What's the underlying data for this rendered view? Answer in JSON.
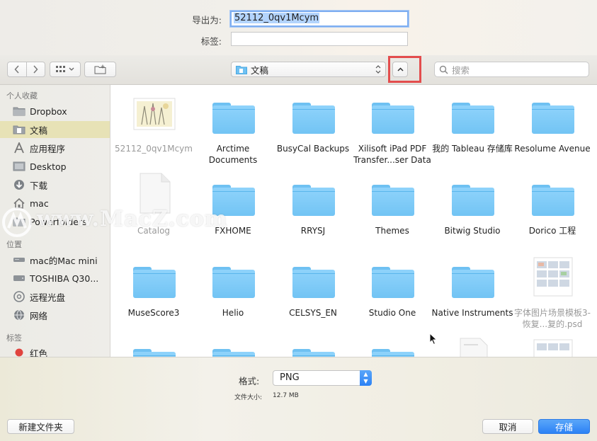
{
  "header": {
    "export_as_label": "导出为:",
    "export_as_value": "52112_0qv1Mcym",
    "tags_label": "标签:",
    "tags_value": ""
  },
  "toolbar": {
    "back_icon": "chevron-left-icon",
    "forward_icon": "chevron-right-icon",
    "view_icon": "grid-view-icon",
    "new_folder_icon": "new-folder-icon",
    "location": "文稿",
    "expand_icon": "chevron-up-icon",
    "search_placeholder": "搜索"
  },
  "sidebar": {
    "favorites_title": "个人收藏",
    "favorites": [
      {
        "label": "Dropbox",
        "icon": "folder-icon"
      },
      {
        "label": "文稿",
        "icon": "documents-icon",
        "active": true
      },
      {
        "label": "应用程序",
        "icon": "applications-icon"
      },
      {
        "label": "Desktop",
        "icon": "desktop-icon"
      },
      {
        "label": "下载",
        "icon": "downloads-icon"
      },
      {
        "label": "mac",
        "icon": "home-icon"
      },
      {
        "label": "Powerfolders",
        "icon": "folder-icon"
      }
    ],
    "locations_title": "位置",
    "locations": [
      {
        "label": "mac的Mac mini",
        "icon": "computer-icon"
      },
      {
        "label": "TOSHIBA Q30...",
        "icon": "drive-icon"
      },
      {
        "label": "远程光盘",
        "icon": "disc-icon"
      },
      {
        "label": "网络",
        "icon": "network-icon"
      }
    ],
    "tags_title": "标签",
    "tags": [
      {
        "label": "红色",
        "color": "#e0443e"
      }
    ]
  },
  "files": {
    "row1": [
      {
        "name": "52112_0qv1Mcym",
        "kind": "image",
        "dim": true
      },
      {
        "name": "Arctime Documents",
        "kind": "folder"
      },
      {
        "name": "BusyCal Backups",
        "kind": "folder"
      },
      {
        "name": "Xilisoft iPad PDF Transfer...ser Data",
        "kind": "folder"
      },
      {
        "name": "我的 Tableau 存储库",
        "kind": "folder"
      },
      {
        "name": "Resolume Avenue",
        "kind": "folder"
      }
    ],
    "row2": [
      {
        "name": "Catalog",
        "kind": "file",
        "dim": true
      },
      {
        "name": "FXHOME",
        "kind": "folder"
      },
      {
        "name": "RRYSJ",
        "kind": "folder"
      },
      {
        "name": "Themes",
        "kind": "folder"
      },
      {
        "name": "Bitwig Studio",
        "kind": "folder"
      },
      {
        "name": "Dorico 工程",
        "kind": "folder"
      }
    ],
    "row3": [
      {
        "name": "MuseScore3",
        "kind": "folder"
      },
      {
        "name": "Helio",
        "kind": "folder"
      },
      {
        "name": "CELSYS_EN",
        "kind": "folder"
      },
      {
        "name": "Studio One",
        "kind": "folder"
      },
      {
        "name": "Native Instruments",
        "kind": "folder"
      },
      {
        "name": "字体图片场景模板3-恢复...复的.psd",
        "kind": "psd",
        "dim": true
      }
    ]
  },
  "watermark": "www.MacZ.com",
  "format": {
    "label": "格式:",
    "value": "PNG",
    "size_label": "文件大小:",
    "size_value": "12.7 MB"
  },
  "footer": {
    "new_folder": "新建文件夹",
    "cancel": "取消",
    "save": "存储"
  }
}
